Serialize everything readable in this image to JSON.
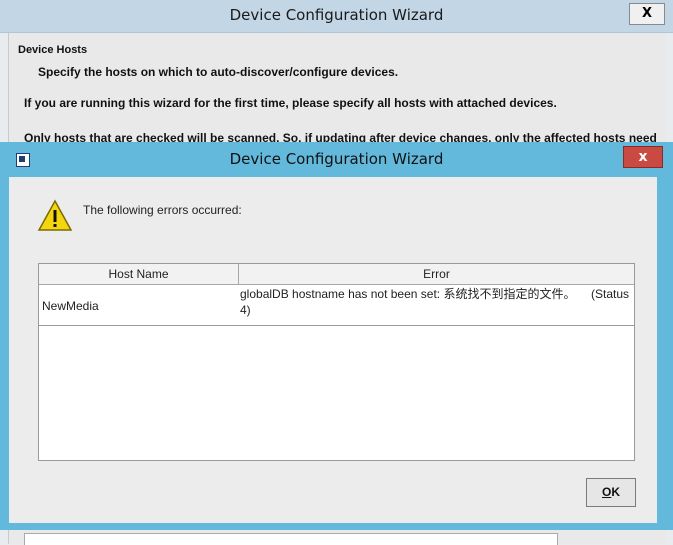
{
  "outer_window": {
    "title": "Device Configuration Wizard",
    "close_glyph": "X",
    "heading": "Device Hosts",
    "subheading": "Specify the hosts on which to auto-discover/configure devices.",
    "line1": "If you are running this wizard for the first time, please specify all hosts with attached devices.",
    "line2": "Only hosts that are checked will be scanned.  So, if updating after device changes, only the affected hosts need"
  },
  "dialog": {
    "title": "Device Configuration Wizard",
    "close_glyph": "x",
    "message": "The following errors occurred:",
    "table": {
      "columns": [
        "Host Name",
        "Error"
      ],
      "rows": [
        {
          "host": "NewMedia",
          "error": "globalDB hostname has not been set: 系统找不到指定的文件。",
          "status_a": "(Status",
          "status_b": "4)"
        }
      ]
    },
    "ok_mnemonic": "O",
    "ok_rest": "K"
  },
  "colors": {
    "dialog_frame": "#62b9dc",
    "close_red": "#c84a42",
    "warning_yellow": "#f4d60f"
  }
}
